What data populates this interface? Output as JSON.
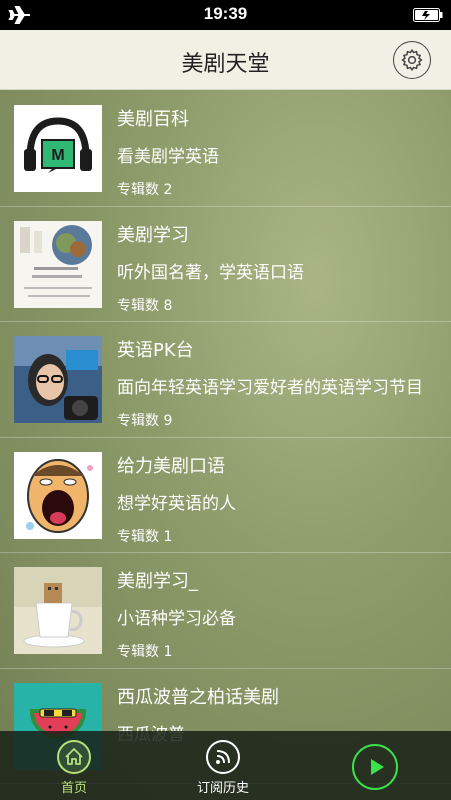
{
  "status_bar": {
    "time": "19:39",
    "airplane_icon": "airplane-icon",
    "battery_icon": "battery-charging-icon"
  },
  "nav": {
    "title": "美剧天堂",
    "settings_icon": "gear-icon"
  },
  "list": [
    {
      "title": "美剧百科",
      "subtitle": "看美剧学英语",
      "count": "专辑数 2"
    },
    {
      "title": "美剧学习",
      "subtitle": "听外国名著，学英语口语",
      "count": "专辑数 8"
    },
    {
      "title": "英语PK台",
      "subtitle": "面向年轻英语学习爱好者的英语学习节目",
      "count": "专辑数 9"
    },
    {
      "title": "给力美剧口语",
      "subtitle": "想学好英语的人",
      "count": "专辑数 1"
    },
    {
      "title": "美剧学习_",
      "subtitle": "小语种学习必备",
      "count": "专辑数 1"
    },
    {
      "title": "西瓜波普之柏话美剧",
      "subtitle": "西瓜波普",
      "count": ""
    }
  ],
  "tabs": {
    "home": {
      "label": "首页",
      "icon": "home-icon"
    },
    "history": {
      "label": "订阅历史",
      "icon": "rss-icon"
    },
    "play": {
      "icon": "play-icon"
    }
  },
  "colors": {
    "accent": "#39e34b",
    "nav_bg": "#f1f0e4"
  }
}
